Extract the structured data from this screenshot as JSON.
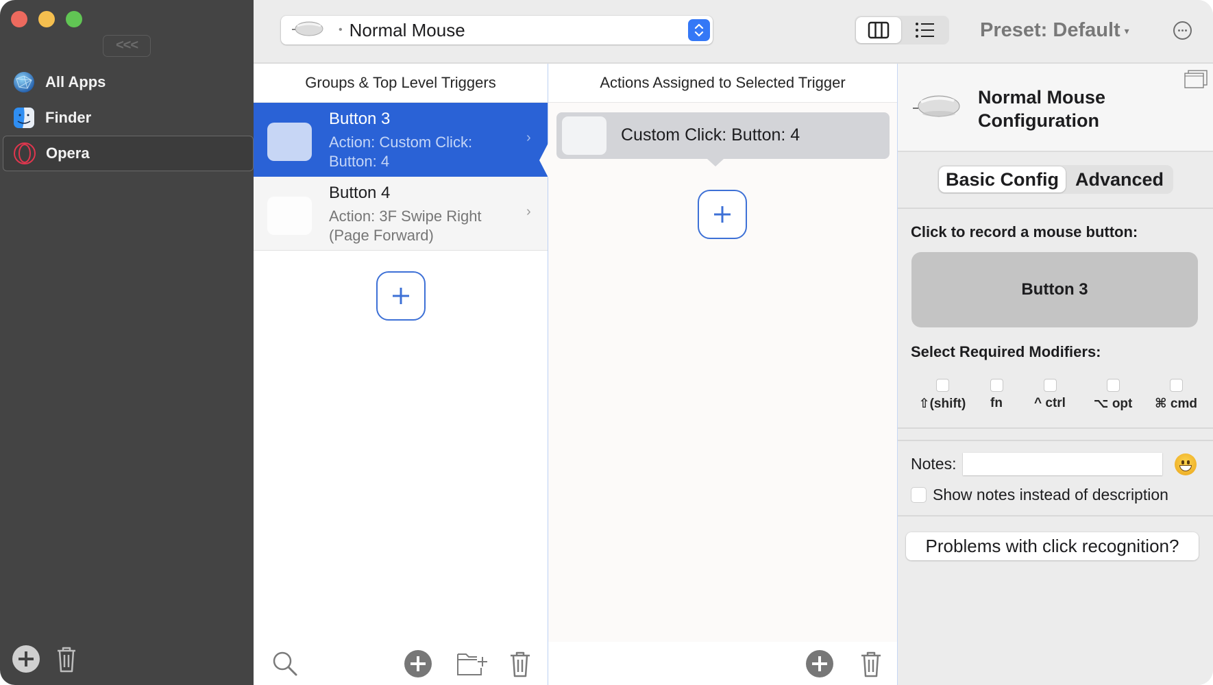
{
  "sidebar": {
    "collapse_label": "<<<",
    "items": [
      {
        "label": "All Apps",
        "icon": "globe-network-icon",
        "selected": false
      },
      {
        "label": "Finder",
        "icon": "finder-icon",
        "selected": false
      },
      {
        "label": "Opera",
        "icon": "opera-icon",
        "selected": true
      }
    ],
    "footer": {
      "add_icon": "circle-plus-icon",
      "delete_icon": "trash-icon"
    }
  },
  "toolbar": {
    "device": {
      "name": "Normal Mouse",
      "icon": "mouse-icon"
    },
    "view_modes": [
      {
        "name": "columns",
        "icon": "columns-icon",
        "active": true
      },
      {
        "name": "list",
        "icon": "list-icon",
        "active": false
      }
    ],
    "preset_label": "Preset: Default",
    "preset_caret": "▾",
    "more_icon": "ellipsis-circle-icon"
  },
  "triggers_column": {
    "header": "Groups & Top Level Triggers",
    "items": [
      {
        "title": "Button 3",
        "description": "Action: Custom Click: Button: 4",
        "selected": true
      },
      {
        "title": "Button 4",
        "description": "Action: 3F Swipe Right (Page Forward)",
        "selected": false
      }
    ],
    "chevron": "›",
    "footer_icons": [
      "search-icon",
      "circle-plus-icon",
      "new-folder-icon",
      "trash-icon"
    ]
  },
  "actions_column": {
    "header": "Actions Assigned to Selected Trigger",
    "items": [
      {
        "label": "Custom Click: Button: 4"
      }
    ],
    "footer_icons": [
      "circle-plus-icon",
      "trash-icon"
    ]
  },
  "config_panel": {
    "title": "Normal Mouse Configuration",
    "tabs": [
      {
        "label": "Basic Config",
        "active": true
      },
      {
        "label": "Advanced",
        "active": false
      }
    ],
    "record_label": "Click to record a mouse button:",
    "recorded_button": "Button 3",
    "modifiers_label": "Select Required Modifiers:",
    "modifiers": [
      {
        "label": "⇧(shift)",
        "checked": false
      },
      {
        "label": "fn",
        "checked": false
      },
      {
        "label": "^ ctrl",
        "checked": false
      },
      {
        "label": "⌥ opt",
        "checked": false
      },
      {
        "label": "⌘ cmd",
        "checked": false
      }
    ],
    "notes_label": "Notes:",
    "notes_value": "",
    "show_notes_label": "Show notes instead of description",
    "show_notes_checked": false,
    "problems_button": "Problems with click recognition?"
  }
}
